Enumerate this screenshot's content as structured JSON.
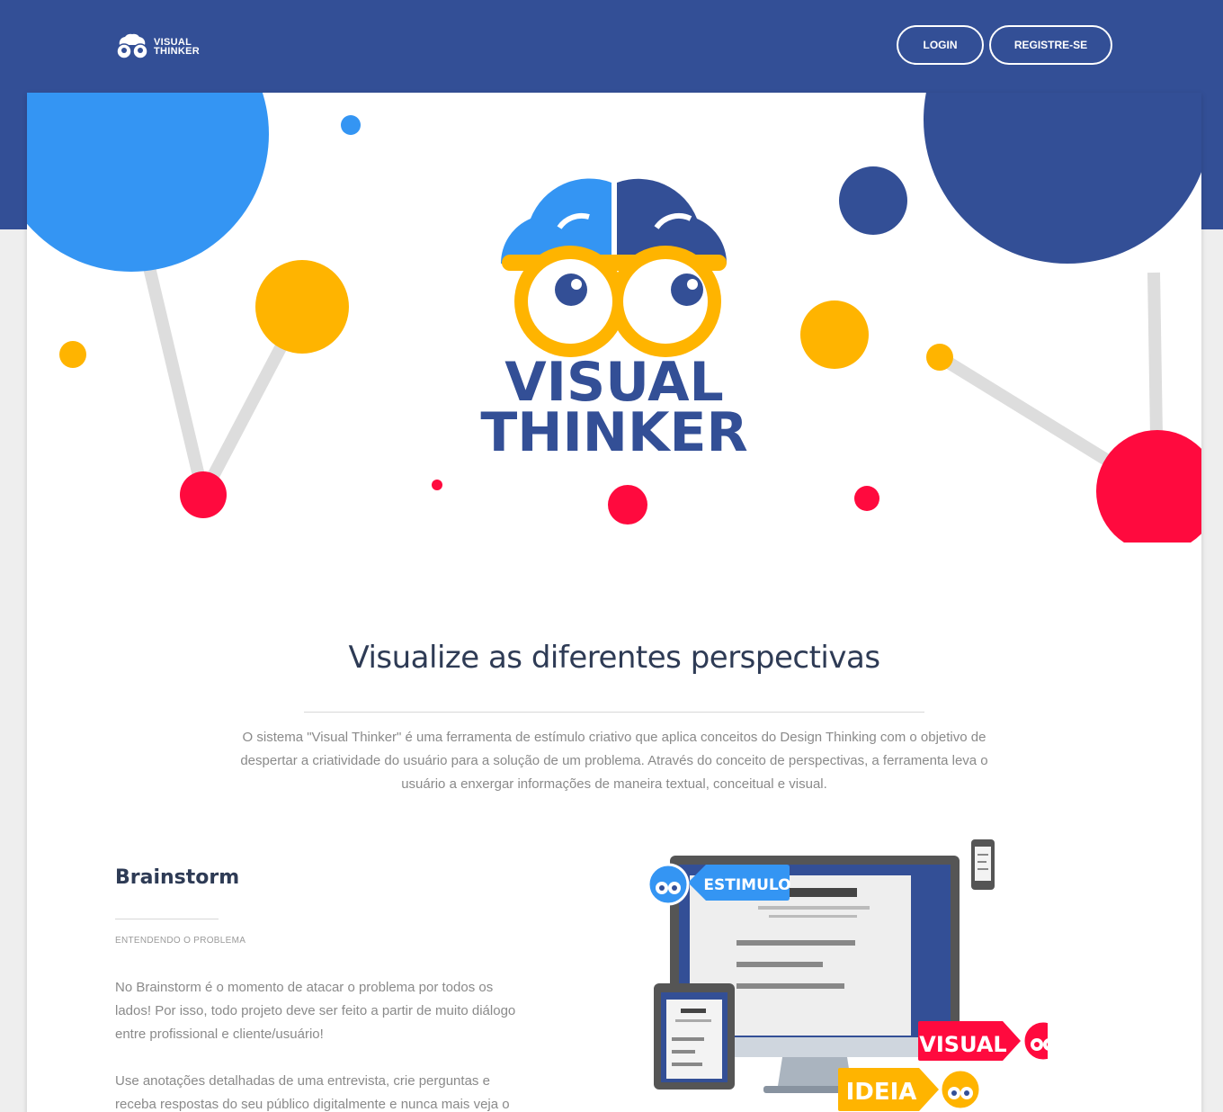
{
  "brand": {
    "name_line1": "VISUAL",
    "name_line2": "THINKER",
    "colors": {
      "navy": "#334f96",
      "blue": "#3495f3",
      "yellow": "#ffb400",
      "red": "#ff0a3e",
      "gray": "#dddddd"
    }
  },
  "nav": {
    "login_label": "LOGIN",
    "register_label": "REGISTRE-SE"
  },
  "hero": {
    "logo_line1": "VISUAL",
    "logo_line2": "THINKER"
  },
  "intro": {
    "title": "Visualize as diferentes perspectivas",
    "text": "O sistema \"Visual Thinker\" é uma ferramenta de estímulo criativo que aplica conceitos do Design Thinking com o objetivo de despertar a criatividade do usuário para a solução de um problema. Através do conceito de perspectivas, a ferramenta leva o usuário a enxergar informações de maneira textual, conceitual e visual."
  },
  "brainstorm": {
    "title": "Brainstorm",
    "subtitle": "ENTENDENDO O PROBLEMA",
    "paragraph1": "No Brainstorm é o momento de atacar o problema por todos os lados! Por isso, todo projeto deve ser feito a partir de muito diálogo entre profissional e cliente/usuário!",
    "paragraph2": "Use anotações detalhadas de uma entrevista, crie perguntas e receba respostas do seu público digitalmente e nunca mais veja o"
  },
  "illustration": {
    "tag_stimulus": "ESTIMULO",
    "tag_visual": "VISUAL",
    "tag_idea": "IDEIA",
    "icons": [
      "monitor-icon",
      "tablet-icon",
      "phone-icon",
      "brain-glasses-icon"
    ]
  }
}
